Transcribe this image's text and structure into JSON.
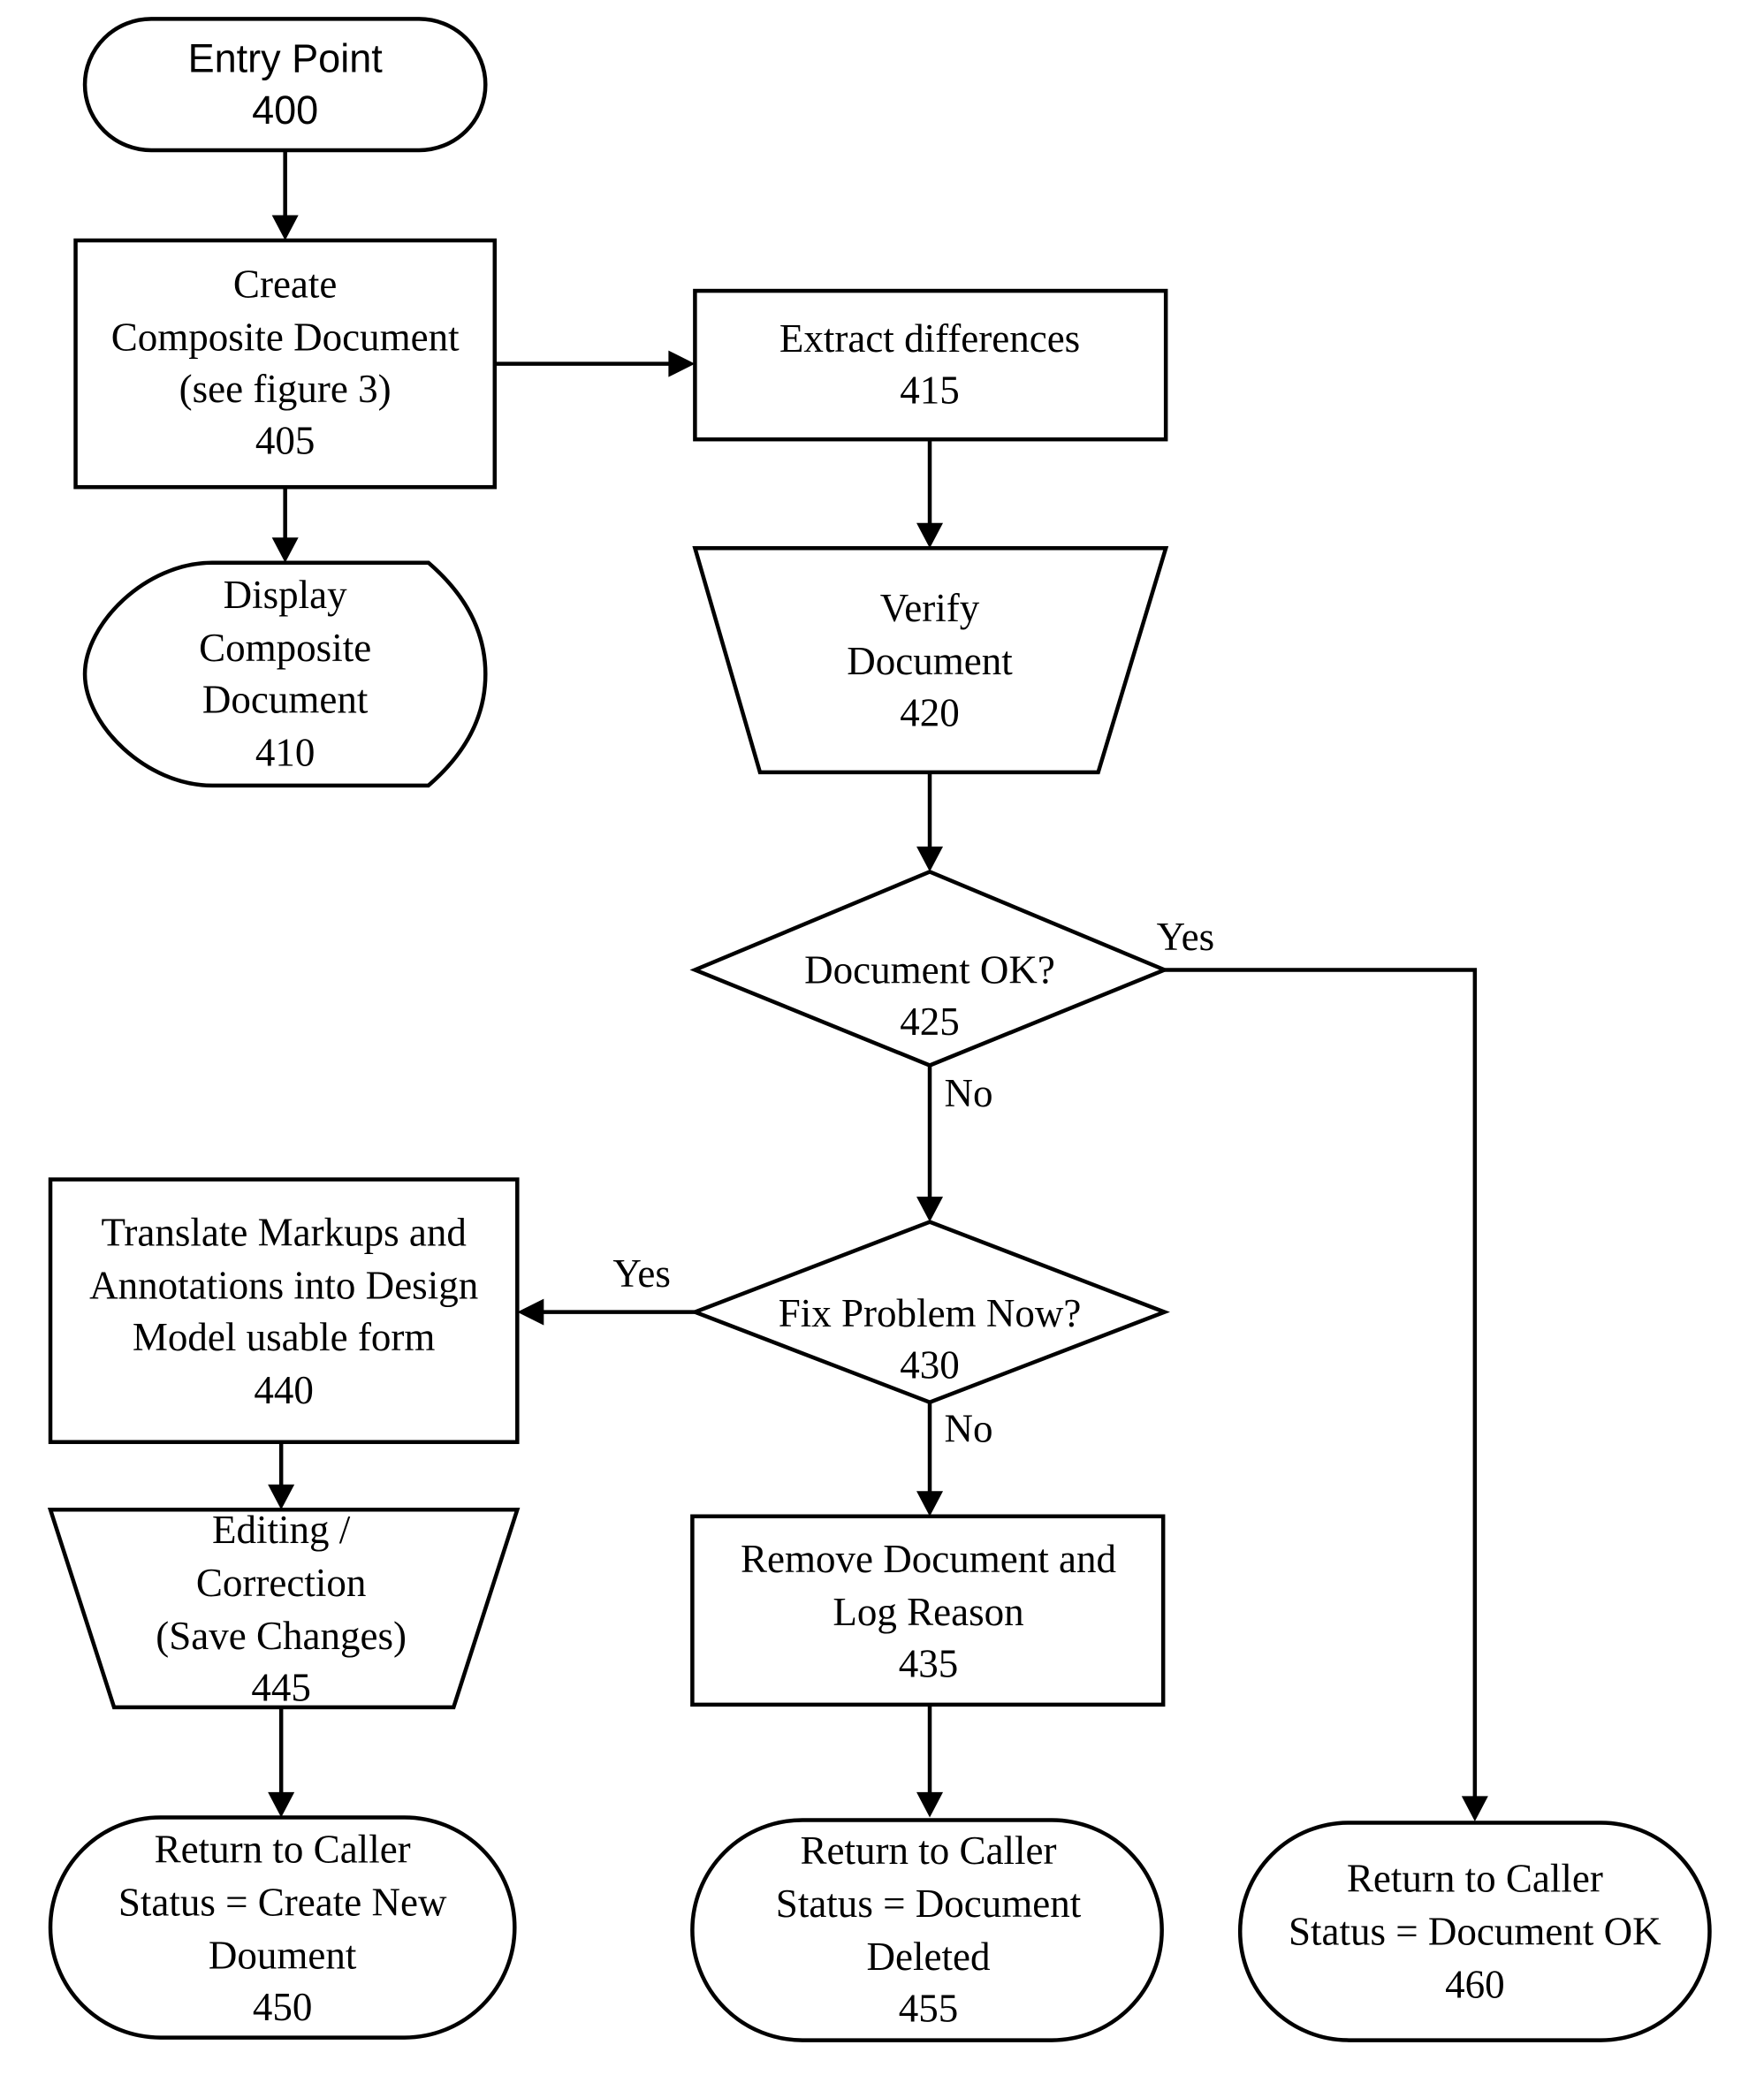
{
  "diagram": {
    "type": "flowchart",
    "nodes": {
      "n400": {
        "id": "400",
        "shape": "terminator",
        "lines": [
          "Entry Point",
          "400"
        ]
      },
      "n405": {
        "id": "405",
        "shape": "process",
        "lines": [
          "Create",
          "Composite Document",
          "(see figure 3)",
          "405"
        ]
      },
      "n410": {
        "id": "410",
        "shape": "display",
        "lines": [
          "Display",
          "Composite",
          "Document",
          "410"
        ]
      },
      "n415": {
        "id": "415",
        "shape": "process",
        "lines": [
          "Extract differences",
          "415"
        ]
      },
      "n420": {
        "id": "420",
        "shape": "manual-operation",
        "lines": [
          "Verify",
          "Document",
          "420"
        ]
      },
      "n425": {
        "id": "425",
        "shape": "decision",
        "lines": [
          "Document OK?",
          "425"
        ]
      },
      "n430": {
        "id": "430",
        "shape": "decision",
        "lines": [
          "Fix Problem Now?",
          "430"
        ]
      },
      "n435": {
        "id": "435",
        "shape": "process",
        "lines": [
          "Remove Document and",
          "Log Reason",
          "435"
        ]
      },
      "n440": {
        "id": "440",
        "shape": "process",
        "lines": [
          "Translate Markups and",
          "Annotations into Design",
          "Model usable form",
          "440"
        ]
      },
      "n445": {
        "id": "445",
        "shape": "manual-operation",
        "lines": [
          "Editing /",
          "Correction",
          "(Save Changes)",
          "445"
        ]
      },
      "n450": {
        "id": "450",
        "shape": "terminator",
        "lines": [
          "Return to Caller",
          "Status = Create New",
          "Doument",
          "450"
        ]
      },
      "n455": {
        "id": "455",
        "shape": "terminator",
        "lines": [
          "Return to Caller",
          "Status = Document",
          "Deleted",
          "455"
        ]
      },
      "n460": {
        "id": "460",
        "shape": "terminator",
        "lines": [
          "Return to Caller",
          "Status = Document OK",
          "460"
        ]
      }
    },
    "edges": [
      {
        "from": "400",
        "to": "405",
        "label": ""
      },
      {
        "from": "405",
        "to": "410",
        "label": ""
      },
      {
        "from": "405",
        "to": "415",
        "label": ""
      },
      {
        "from": "415",
        "to": "420",
        "label": ""
      },
      {
        "from": "420",
        "to": "425",
        "label": ""
      },
      {
        "from": "425",
        "to": "460",
        "label": "Yes"
      },
      {
        "from": "425",
        "to": "430",
        "label": "No"
      },
      {
        "from": "430",
        "to": "440",
        "label": "Yes"
      },
      {
        "from": "430",
        "to": "435",
        "label": "No"
      },
      {
        "from": "440",
        "to": "445",
        "label": ""
      },
      {
        "from": "445",
        "to": "450",
        "label": ""
      },
      {
        "from": "435",
        "to": "455",
        "label": ""
      }
    ],
    "edge_labels": {
      "yes_425": "Yes",
      "no_425": "No",
      "yes_430": "Yes",
      "no_430": "No"
    }
  }
}
